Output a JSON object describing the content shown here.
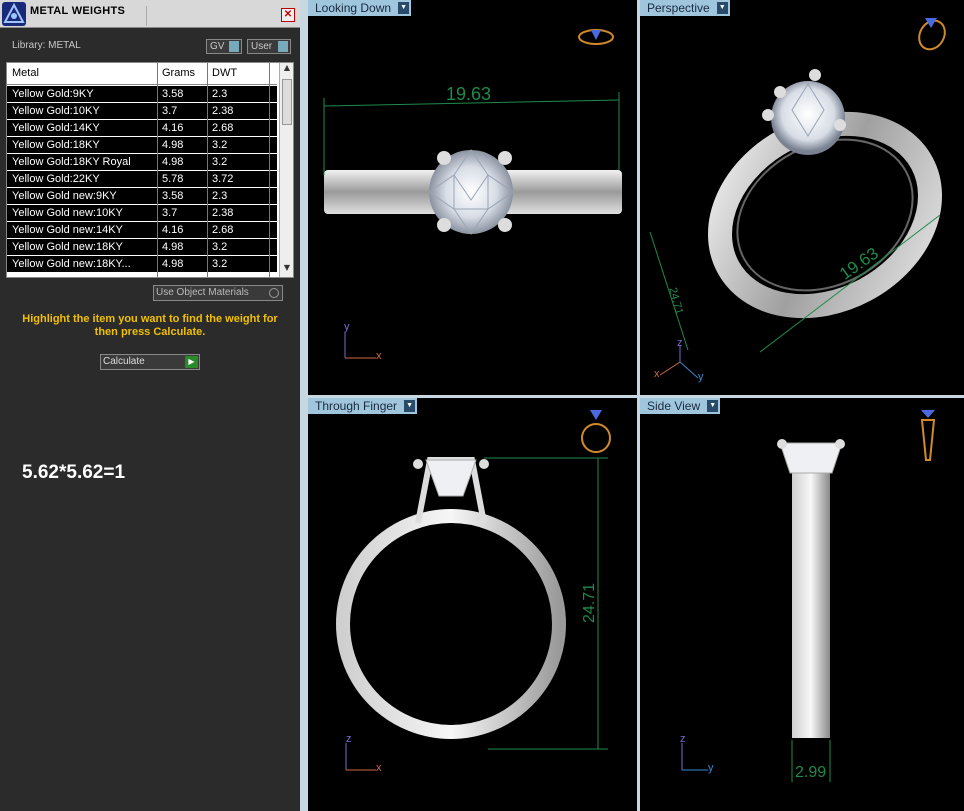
{
  "panel": {
    "title": "METAL WEIGHTS",
    "close_label": "✕",
    "library_label": "Library: METAL",
    "gv_label": "GV",
    "user_label": "User",
    "table": {
      "headers": [
        "Metal",
        "Grams",
        "DWT"
      ],
      "rows": [
        [
          "Yellow Gold:9KY",
          "3.58",
          "2.3"
        ],
        [
          "Yellow Gold:10KY",
          "3.7",
          "2.38"
        ],
        [
          "Yellow Gold:14KY",
          "4.16",
          "2.68"
        ],
        [
          "Yellow Gold:18KY",
          "4.98",
          "3.2"
        ],
        [
          "Yellow Gold:18KY Royal",
          "4.98",
          "3.2"
        ],
        [
          "Yellow Gold:22KY",
          "5.78",
          "3.72"
        ],
        [
          "Yellow Gold new:9KY",
          "3.58",
          "2.3"
        ],
        [
          "Yellow Gold new:10KY",
          "3.7",
          "2.38"
        ],
        [
          "Yellow Gold new:14KY",
          "4.16",
          "2.68"
        ],
        [
          "Yellow Gold new:18KY",
          "4.98",
          "3.2"
        ],
        [
          "Yellow Gold new:18KY...",
          "4.98",
          "3.2"
        ]
      ]
    },
    "use_object_materials": "Use Object Materials",
    "hint": "Highlight the item you want to find the weight for then press Calculate.",
    "calculate_label": "Calculate",
    "formula": "5.62*5.62=1"
  },
  "viewports": [
    {
      "label": "Looking Down",
      "dimensions": [
        "19.63"
      ],
      "axes": [
        "y",
        "x"
      ]
    },
    {
      "label": "Perspective",
      "dimensions": [
        "19.63",
        "24.71"
      ],
      "axes": [
        "z",
        "x",
        "y"
      ]
    },
    {
      "label": "Through Finger",
      "dimensions": [
        "24.71"
      ],
      "axes": [
        "z",
        "x"
      ]
    },
    {
      "label": "Side View",
      "dimensions": [
        "2.99"
      ],
      "axes": [
        "z",
        "y"
      ]
    }
  ],
  "colors": {
    "panel_bg": "#2b2b2b",
    "viewport_bg": "#000000",
    "tab_bg": "#9fc6dc",
    "dimension_green": "#1f8a4a",
    "hint_yellow": "#f0c000"
  }
}
